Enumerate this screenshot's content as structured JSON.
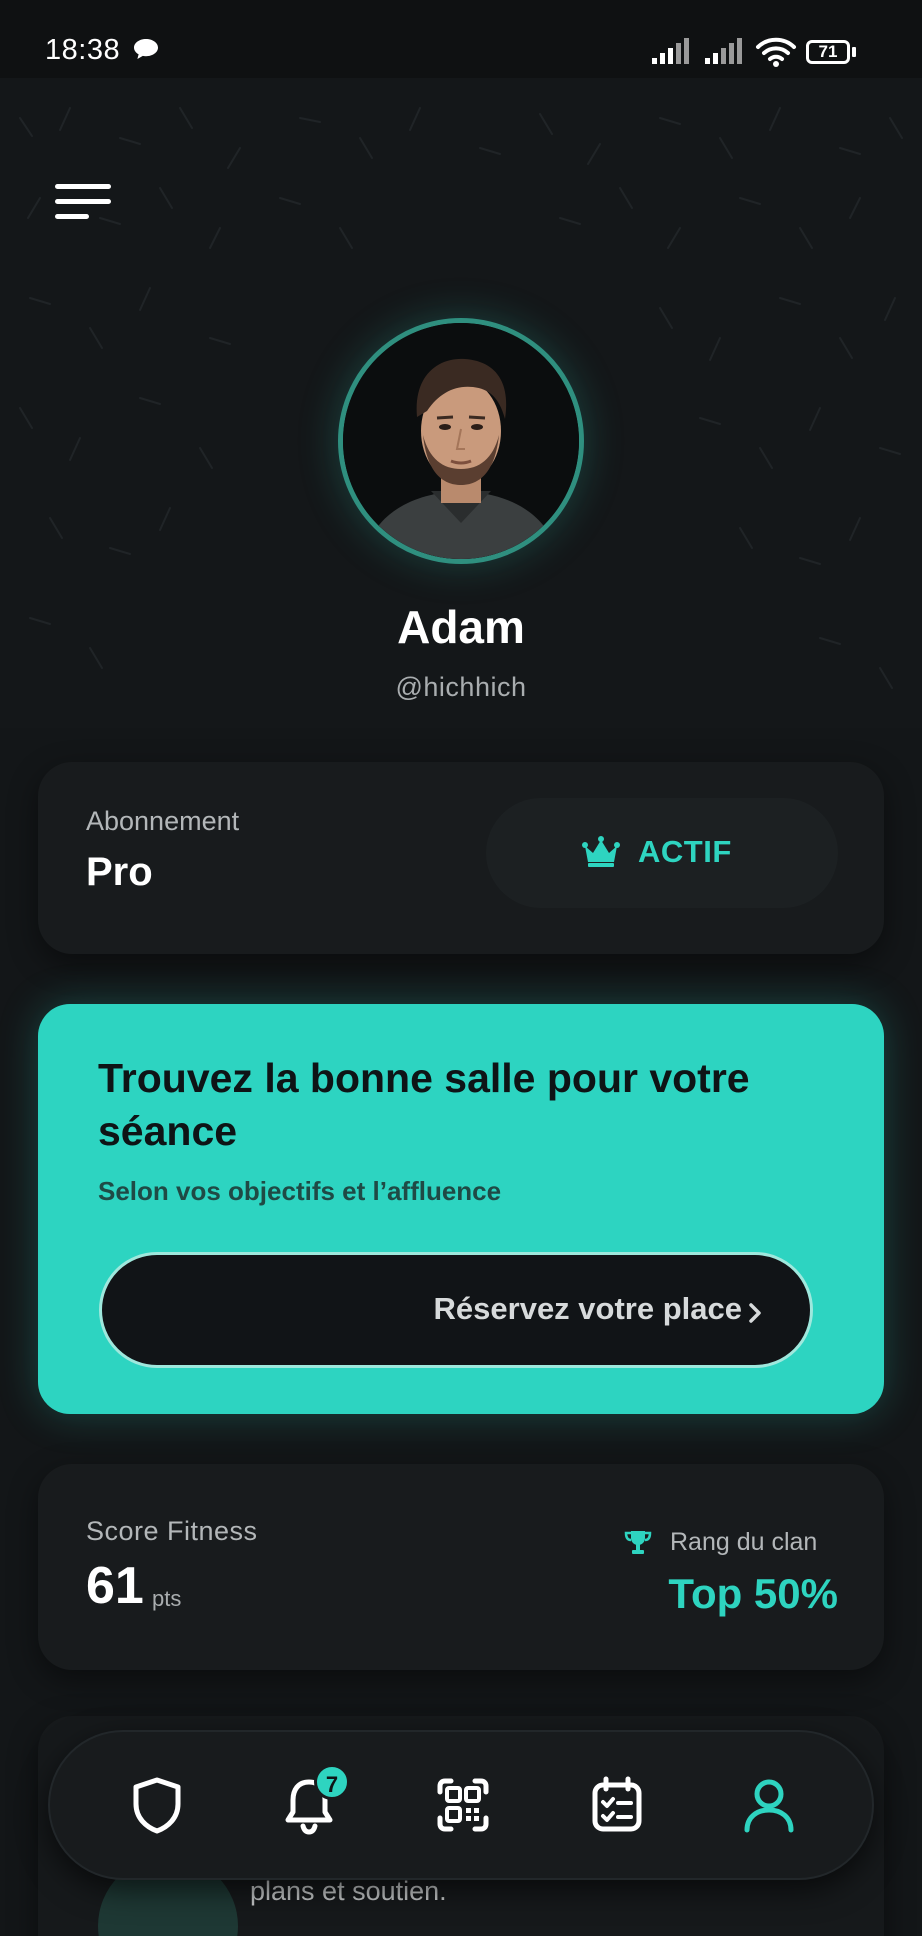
{
  "status_bar": {
    "time": "18:38",
    "battery": "71",
    "icons": [
      "chat-bubble-icon",
      "signal-icon",
      "signal-icon",
      "wifi-icon",
      "battery-icon"
    ]
  },
  "header": {
    "menu_icon": "menu-icon"
  },
  "profile": {
    "name": "Adam",
    "handle": "@hichhich"
  },
  "subscription": {
    "label": "Abonnement",
    "plan": "Pro",
    "status": "ACTIF",
    "status_icon": "crown-icon"
  },
  "promo": {
    "title": "Trouvez la bonne salle pour votre séance",
    "subtitle": "Selon vos objectifs et l’affluence",
    "button_label": "Réservez votre place",
    "button_icon": "chevron-right-icon"
  },
  "score": {
    "label": "Score Fitness",
    "value": "61",
    "unit": "pts",
    "rank_label": "Rang du clan",
    "rank_value": "Top 50%",
    "rank_icon": "trophy-icon"
  },
  "hidden_card": {
    "text": "plans et soutien."
  },
  "bottom_nav": {
    "items": [
      {
        "icon": "shield-icon"
      },
      {
        "icon": "bell-icon",
        "badge": "7"
      },
      {
        "icon": "qr-code-icon"
      },
      {
        "icon": "calendar-check-icon"
      },
      {
        "icon": "user-icon",
        "active": true
      }
    ]
  },
  "colors": {
    "accent": "#2ed4c0",
    "background": "#131618",
    "card": "#181b1d",
    "promo": "#2dd4c1"
  }
}
